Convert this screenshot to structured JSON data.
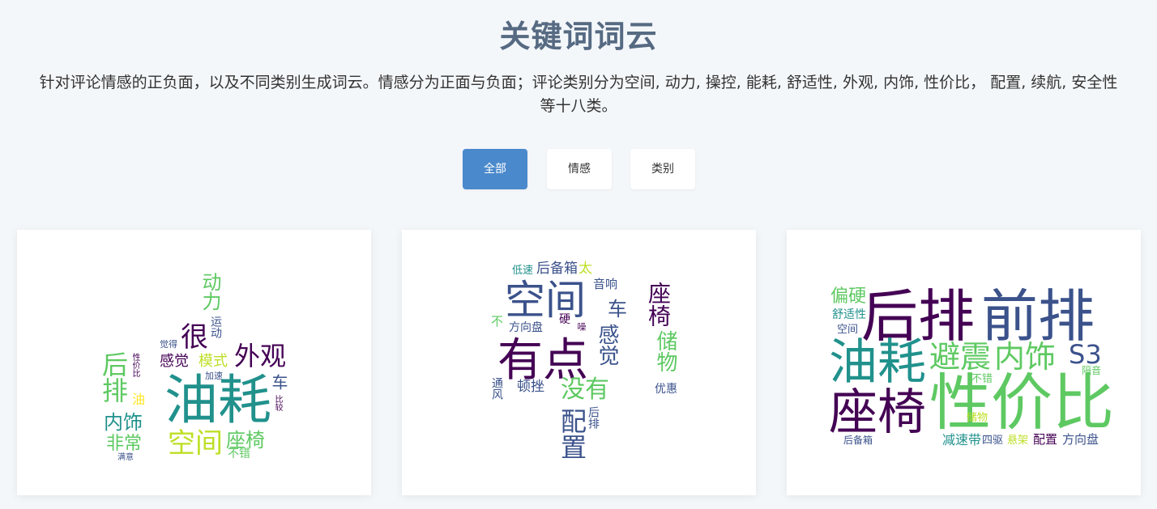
{
  "page": {
    "title": "关键词词云",
    "description_line1": "针对评论情感的正负面，以及不同类别生成词云。情感分为正面与负面；评论类别分为空间, 动力, 操控, 能耗, 舒适性, 外观, 内饰, 性价比， 配置, 续航, 安全性",
    "description_line2": "等十八类。"
  },
  "tabs": [
    {
      "label": "全部",
      "active": true
    },
    {
      "label": "情感",
      "active": false
    },
    {
      "label": "类别",
      "active": false
    }
  ],
  "colors": {
    "accent": "#4a89cc",
    "title": "#566a82",
    "viridis": [
      "#440154",
      "#3b528b",
      "#21918c",
      "#5ec962",
      "#bddf26",
      "#fde725"
    ]
  },
  "clouds": [
    {
      "words": [
        "油耗",
        "空间",
        "座椅",
        "外观",
        "很",
        "后排",
        "内饰",
        "非常",
        "动力",
        "感觉",
        "模式",
        "车",
        "油",
        "运动",
        "觉得",
        "性价比",
        "加速",
        "比较",
        "不错",
        "满意"
      ]
    },
    {
      "words": [
        "有点",
        "空间",
        "配置",
        "没有",
        "感觉",
        "座椅",
        "储物",
        "车",
        "音响",
        "后备箱",
        "低速",
        "太",
        "方向盘",
        "硬",
        "噪",
        "不",
        "顿挫",
        "通风",
        "优惠",
        "后排"
      ]
    },
    {
      "words": [
        "后排",
        "前排",
        "油耗",
        "座椅",
        "性价比",
        "避震",
        "内饰",
        "S3",
        "偏硬",
        "舒适性",
        "空间",
        "不错",
        "隔音",
        "储物",
        "减速带",
        "四驱",
        "悬架",
        "配置",
        "方向盘",
        "后备箱"
      ]
    }
  ]
}
